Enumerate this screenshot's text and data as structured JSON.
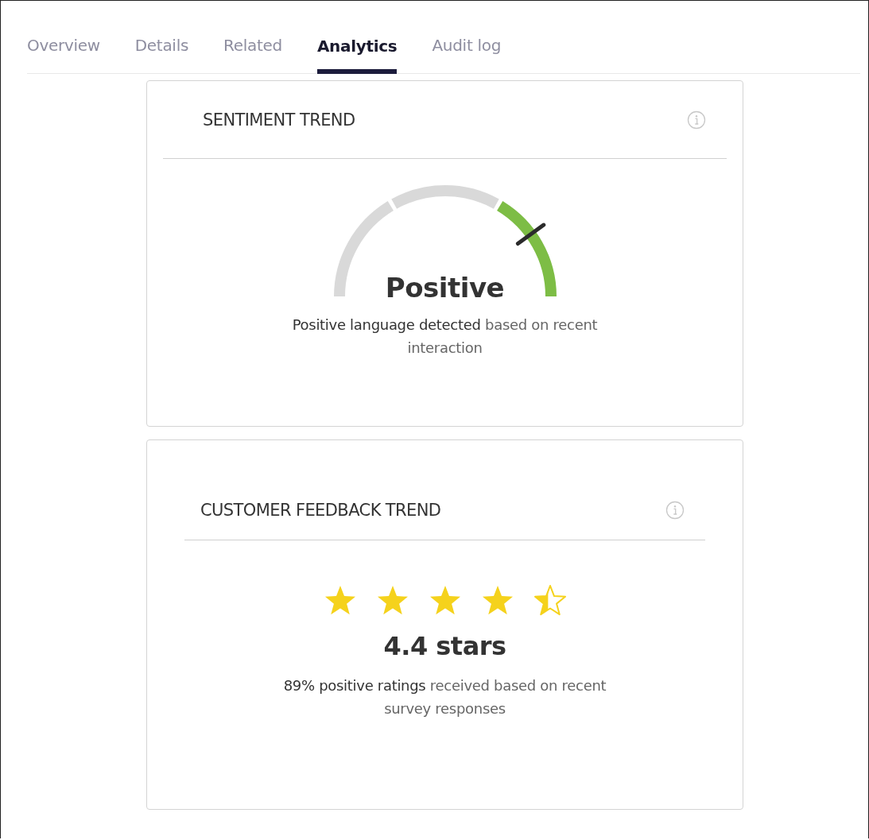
{
  "tabs": [
    {
      "label": "Overview",
      "selected": false
    },
    {
      "label": "Details",
      "selected": false
    },
    {
      "label": "Related",
      "selected": false
    },
    {
      "label": "Analytics",
      "selected": true
    },
    {
      "label": "Audit log",
      "selected": false
    }
  ],
  "cards": [
    {
      "kind": "gauge",
      "title": "SENTIMENT TREND",
      "value": "Positive",
      "description": "**Positive language detected** based on recent interaction"
    },
    {
      "kind": "rating",
      "title": "CUSTOMER FEEDBACK TREND",
      "stars": 4.4,
      "value": "4.4 stars",
      "description": "**89% positive ratings** received based on recent survey responses"
    }
  ]
}
